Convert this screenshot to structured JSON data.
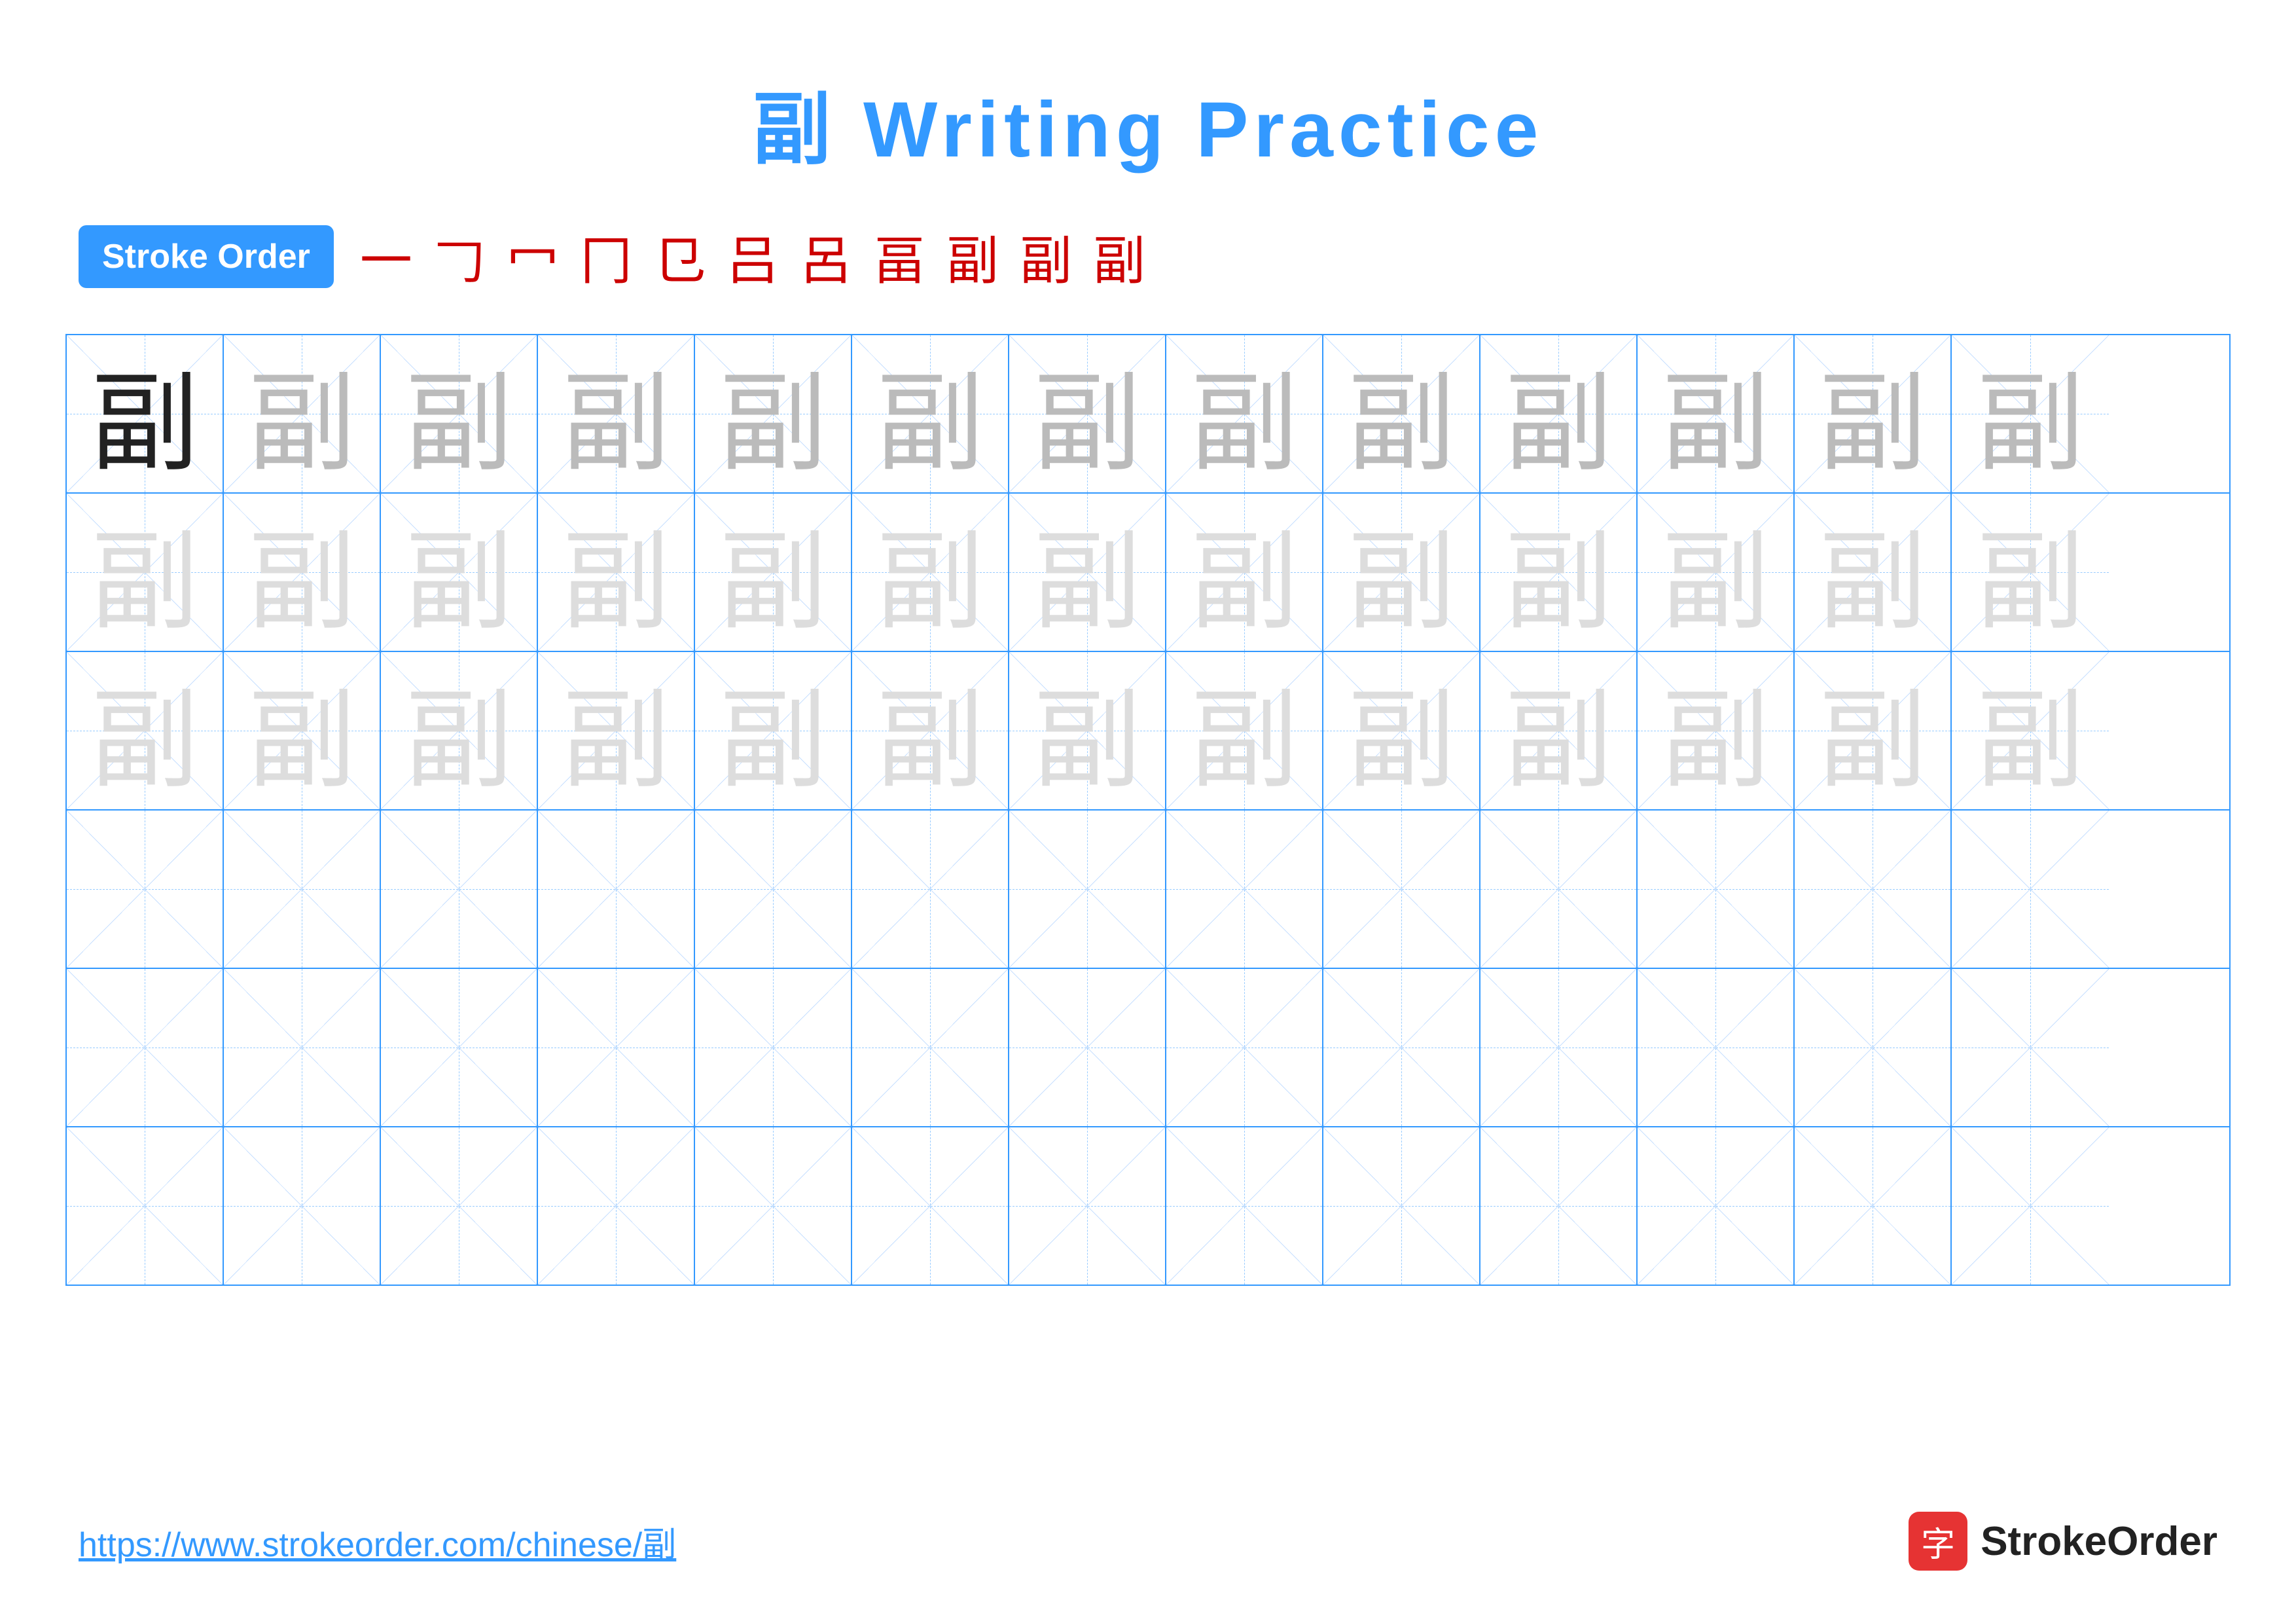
{
  "title": "副 Writing Practice",
  "strokeOrder": {
    "badge": "Stroke Order",
    "strokes": [
      "一",
      "𠃌",
      "冖",
      "冂",
      "㔾",
      "吕",
      "呂",
      "畐",
      "畐",
      "副",
      "副"
    ]
  },
  "character": "副",
  "grid": {
    "rows": 6,
    "cols": 13
  },
  "footer": {
    "url": "https://www.strokeorder.com/chinese/副",
    "logoChar": "字",
    "logoText": "StrokeOrder"
  },
  "colors": {
    "blue": "#3399ff",
    "red": "#cc0000",
    "dark": "#222222",
    "medium": "#bbbbbb",
    "light": "#dddddd"
  }
}
